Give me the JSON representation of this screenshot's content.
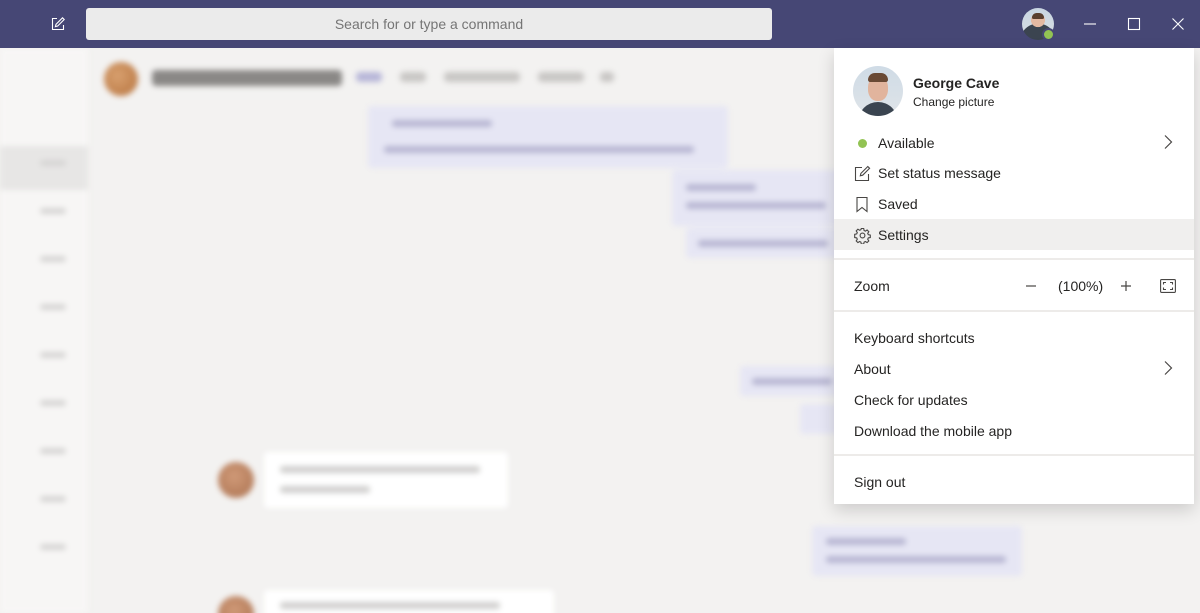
{
  "search": {
    "placeholder": "Search for or type a command"
  },
  "titlebar": {
    "icons": [
      "compose-icon",
      "user-avatar",
      "minimize-icon",
      "maximize-icon",
      "close-icon"
    ],
    "accent_color": "#464775"
  },
  "profile": {
    "name": "George Cave",
    "change_picture": "Change picture",
    "status_color": "#92c353"
  },
  "menu": {
    "status": {
      "label": "Available",
      "icon": "status-available-icon"
    },
    "set_status": {
      "label": "Set status message",
      "icon": "edit-status-icon"
    },
    "saved": {
      "label": "Saved",
      "icon": "bookmark-icon"
    },
    "settings": {
      "label": "Settings",
      "icon": "gear-icon"
    },
    "zoom": {
      "label": "Zoom",
      "value": "(100%)"
    },
    "keyboard_shortcuts": "Keyboard shortcuts",
    "about": "About",
    "check_updates": "Check for updates",
    "download_app": "Download the mobile app",
    "sign_out": "Sign out"
  }
}
